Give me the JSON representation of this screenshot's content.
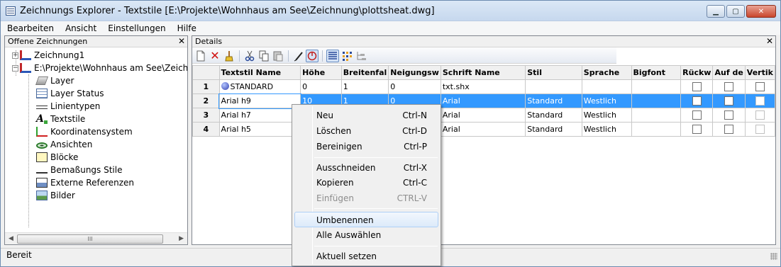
{
  "window": {
    "title": "Zeichnungs Explorer - Textstile [E:\\Projekte\\Wohnhaus am See\\Zeichnung\\plottsheat.dwg]",
    "buttons": {
      "minimize": "▁",
      "maximize": "▢",
      "close": "✕"
    }
  },
  "menubar": [
    "Bearbeiten",
    "Ansicht",
    "Einstellungen",
    "Hilfe"
  ],
  "left_pane": {
    "title": "Offene Zeichnungen",
    "close": "✕",
    "tree": [
      {
        "label": "Zeichnung1",
        "expander": "+",
        "icon": "drawing-icon"
      },
      {
        "label": "E:\\Projekte\\Wohnhaus am See\\Zeichnung",
        "expander": "−",
        "icon": "drawing-icon"
      },
      {
        "label": "Layer",
        "icon": "layer-icon"
      },
      {
        "label": "Layer Status",
        "icon": "layer-status-icon"
      },
      {
        "label": "Linientypen",
        "icon": "linetype-icon"
      },
      {
        "label": "Textstile",
        "icon": "textstyle-icon"
      },
      {
        "label": "Koordinatensystem",
        "icon": "coordinate-system-icon"
      },
      {
        "label": "Ansichten",
        "icon": "view-icon"
      },
      {
        "label": "Blöcke",
        "icon": "block-icon"
      },
      {
        "label": "Bemaßungs Stile",
        "icon": "dimension-style-icon"
      },
      {
        "label": "Externe Referenzen",
        "icon": "xref-icon"
      },
      {
        "label": "Bilder",
        "icon": "image-icon"
      }
    ],
    "scroll_arrows": {
      "left": "◀",
      "right": "▶",
      "thumb": "III"
    }
  },
  "right_pane": {
    "title": "Details",
    "close": "✕",
    "toolbar": [
      "new-icon",
      "delete-icon",
      "purge-icon",
      "cut-icon",
      "copy-icon",
      "paste-icon",
      "rename-icon",
      "set-current-icon",
      "details-view-icon",
      "icon-view-icon",
      "tree-view-icon"
    ],
    "table": {
      "columns": [
        "",
        "Textstil Name",
        "Höhe",
        "Breitenfal",
        "Neigungsw",
        "Schrift Name",
        "Stil",
        "Sprache",
        "Bigfont",
        "Rückw",
        "Auf de",
        "Vertik"
      ],
      "rows": [
        {
          "num": "1",
          "name": "STANDARD",
          "hoehe": "0",
          "breite": "1",
          "neigung": "0",
          "schrift": "txt.shx",
          "stil": "",
          "sprache": "",
          "bigfont": ""
        },
        {
          "num": "2",
          "name": "Arial h9",
          "hoehe": "10",
          "breite": "1",
          "neigung": "0",
          "schrift": "Arial",
          "stil": "Standard",
          "sprache": "Westlich",
          "bigfont": ""
        },
        {
          "num": "3",
          "name": "Arial h7",
          "hoehe": "",
          "breite": "",
          "neigung": "",
          "schrift": "Arial",
          "stil": "Standard",
          "sprache": "Westlich",
          "bigfont": ""
        },
        {
          "num": "4",
          "name": "Arial h5",
          "hoehe": "",
          "breite": "",
          "neigung": "",
          "schrift": "Arial",
          "stil": "Standard",
          "sprache": "Westlich",
          "bigfont": ""
        }
      ]
    }
  },
  "context_menu": {
    "items": [
      {
        "label": "Neu",
        "shortcut": "Ctrl-N",
        "disabled": false
      },
      {
        "label": "Löschen",
        "shortcut": "Ctrl-D",
        "disabled": false
      },
      {
        "label": "Bereinigen",
        "shortcut": "Ctrl-P",
        "disabled": false
      },
      {
        "label": "Ausschneiden",
        "shortcut": "Ctrl-X",
        "disabled": false
      },
      {
        "label": "Kopieren",
        "shortcut": "Ctrl-C",
        "disabled": false
      },
      {
        "label": "Einfügen",
        "shortcut": "CTRL-V",
        "disabled": true
      },
      {
        "label": "Umbenennen",
        "shortcut": "",
        "disabled": false,
        "highlighted": true
      },
      {
        "label": "Alle Auswählen",
        "shortcut": "",
        "disabled": false
      },
      {
        "label": "Aktuell setzen",
        "shortcut": "",
        "disabled": false
      }
    ]
  },
  "statusbar": {
    "text": "Bereit"
  },
  "colors": {
    "selection": "#3399ff",
    "title_gradient_top": "#dbe8f6",
    "title_gradient_bottom": "#c6d8ee"
  }
}
